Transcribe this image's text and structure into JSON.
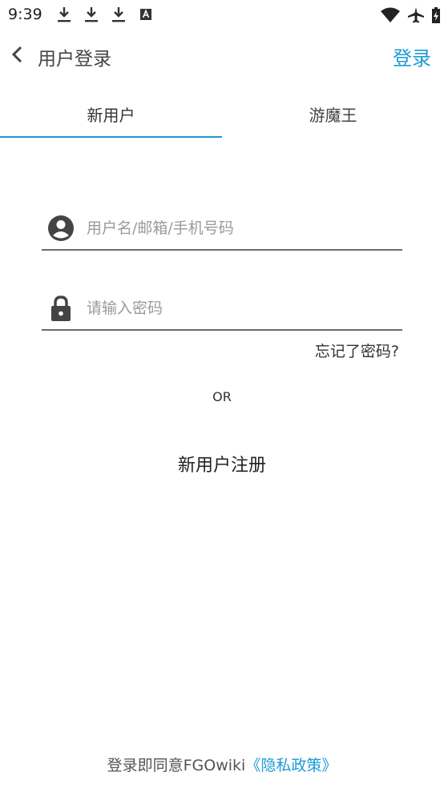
{
  "status_bar": {
    "time": "9:39",
    "left_icons": [
      "download-icon",
      "download-icon",
      "download-icon",
      "notification-a-icon"
    ],
    "right_icons": [
      "wifi-icon",
      "airplane-mode-icon",
      "battery-charging-icon"
    ]
  },
  "app_bar": {
    "title": "用户登录",
    "action_label": "登录",
    "accent_color": "#1a9bd6"
  },
  "tabs": [
    {
      "label": "新用户",
      "selected": true
    },
    {
      "label": "游魔王",
      "selected": false
    }
  ],
  "form": {
    "username_placeholder": "用户名/邮箱/手机号码",
    "username_value": "",
    "password_placeholder": "请输入密码",
    "password_value": "",
    "forgot_label": "忘记了密码?"
  },
  "or_label": "OR",
  "register_label": "新用户注册",
  "footer": {
    "agree_text": "登录即同意FGOwiki",
    "privacy_link": "《隐私政策》"
  }
}
